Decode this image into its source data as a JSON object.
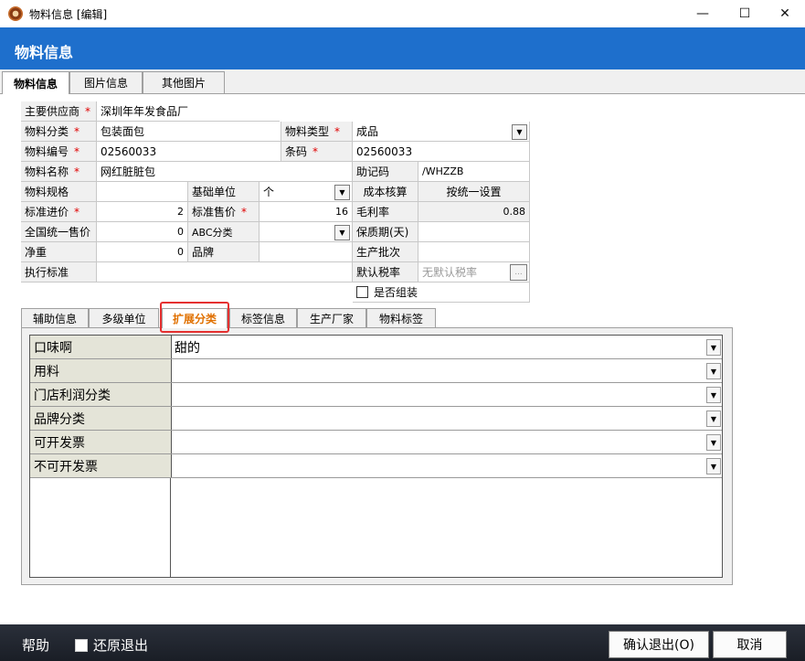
{
  "window": {
    "title": "物料信息 [编辑]",
    "minimize": "—",
    "maximize": "☐",
    "close": "✕"
  },
  "header": {
    "title": "物料信息"
  },
  "top_tabs": [
    "物料信息",
    "图片信息",
    "其他图片"
  ],
  "form": {
    "supplier_label": "主要供应商",
    "supplier_value": "深圳年年发食品厂",
    "category_label": "物料分类",
    "category_value": "包装面包",
    "type_label": "物料类型",
    "type_value": "成品",
    "code_label": "物料编号",
    "code_value": "02560033",
    "barcode_label": "条码",
    "barcode_value": "02560033",
    "name_label": "物料名称",
    "name_value": "网红脏脏包",
    "mnemonic_label": "助记码",
    "mnemonic_value": "/WHZZB",
    "spec_label": "物料规格",
    "spec_value": "",
    "base_unit_label": "基础单位",
    "base_unit_value": "个",
    "cost_label": "成本核算",
    "cost_value": "按统一设置",
    "std_purchase_label": "标准进价",
    "std_purchase_value": "2",
    "std_sale_label": "标准售价",
    "std_sale_value": "16",
    "margin_label": "毛利率",
    "margin_value": "0.88",
    "national_price_label": "全国统一售价",
    "national_price_value": "0",
    "abc_label": "ABC分类",
    "abc_value": "",
    "shelf_life_label": "保质期(天)",
    "shelf_life_value": "",
    "net_weight_label": "净重",
    "net_weight_value": "0",
    "brand_label": "品牌",
    "brand_value": "",
    "batch_label": "生产批次",
    "batch_value": "",
    "standard_label": "执行标准",
    "standard_value": "",
    "tax_label": "默认税率",
    "tax_value": "无默认税率",
    "tax_btn": "...",
    "assembly_label": "是否组装",
    "required_mark": "*"
  },
  "bottom_tabs": [
    "辅助信息",
    "多级单位",
    "扩展分类",
    "标签信息",
    "生产厂家",
    "物料标签"
  ],
  "ext_grid": [
    {
      "name": "口味啊",
      "value": "甜的"
    },
    {
      "name": "用料",
      "value": ""
    },
    {
      "name": "门店利润分类",
      "value": ""
    },
    {
      "name": "品牌分类",
      "value": ""
    },
    {
      "name": "可开发票",
      "value": ""
    },
    {
      "name": "不可开发票",
      "value": ""
    }
  ],
  "footer": {
    "help": "帮助",
    "restore_exit": "还原退出",
    "confirm": "确认退出(O)",
    "cancel": "取消"
  }
}
